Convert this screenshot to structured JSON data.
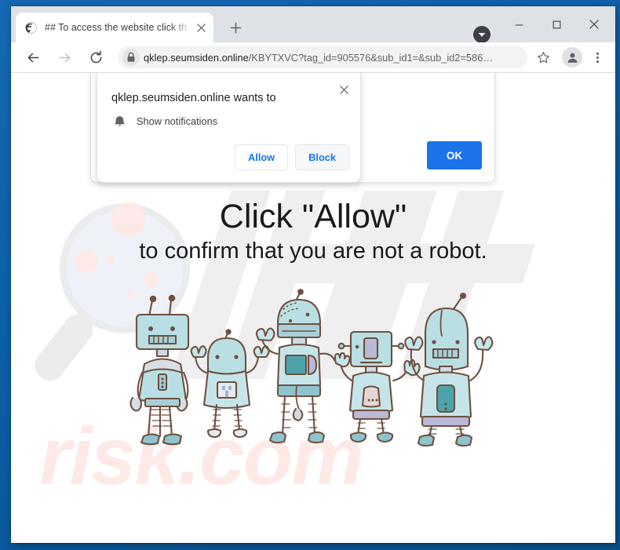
{
  "window": {
    "accent_color": "#0c5ea8",
    "controls": {
      "tab_search": "tab-search-chevron",
      "minimize": "─",
      "maximize": "□",
      "close": "✕"
    }
  },
  "tabstrip": {
    "tab": {
      "favicon": "globe-icon",
      "title": "## To access the website click th",
      "close_label": "✕"
    },
    "new_tab_label": "+"
  },
  "toolbar": {
    "back_icon": "back-arrow-icon",
    "forward_icon": "forward-arrow-icon",
    "reload_icon": "reload-icon",
    "lock_icon": "lock-icon",
    "url_host": "qklep.seumsiden.online",
    "url_path": "/KBYTXVC?tag_id=905576&sub_id1=&sub_id2=586…",
    "url_full": "qklep.seumsiden.online/KBYTXVC?tag_id=905576&sub_id1=&sub_id2=586…",
    "star_icon": "star-icon",
    "avatar_icon": "profile-avatar-icon",
    "menu_icon": "three-dot-menu-icon"
  },
  "permission_dialog": {
    "title": "qklep.seumsiden.online wants to",
    "close_label": "✕",
    "permission_icon": "bell-icon",
    "permission_label": "Show notifications",
    "allow_label": "Allow",
    "block_label": "Block",
    "accent_color": "#1a73e8"
  },
  "js_dialog": {
    "ok_label": "OK",
    "ok_color": "#1a73e8"
  },
  "page": {
    "headline": "Click \"Allow\"",
    "subheadline": "to confirm that you are not a robot.",
    "illustration": "five-cartoon-robots",
    "watermark_text": "risk.com",
    "watermark_logo": "magnifier-icon",
    "background_color": "#ffffff"
  }
}
